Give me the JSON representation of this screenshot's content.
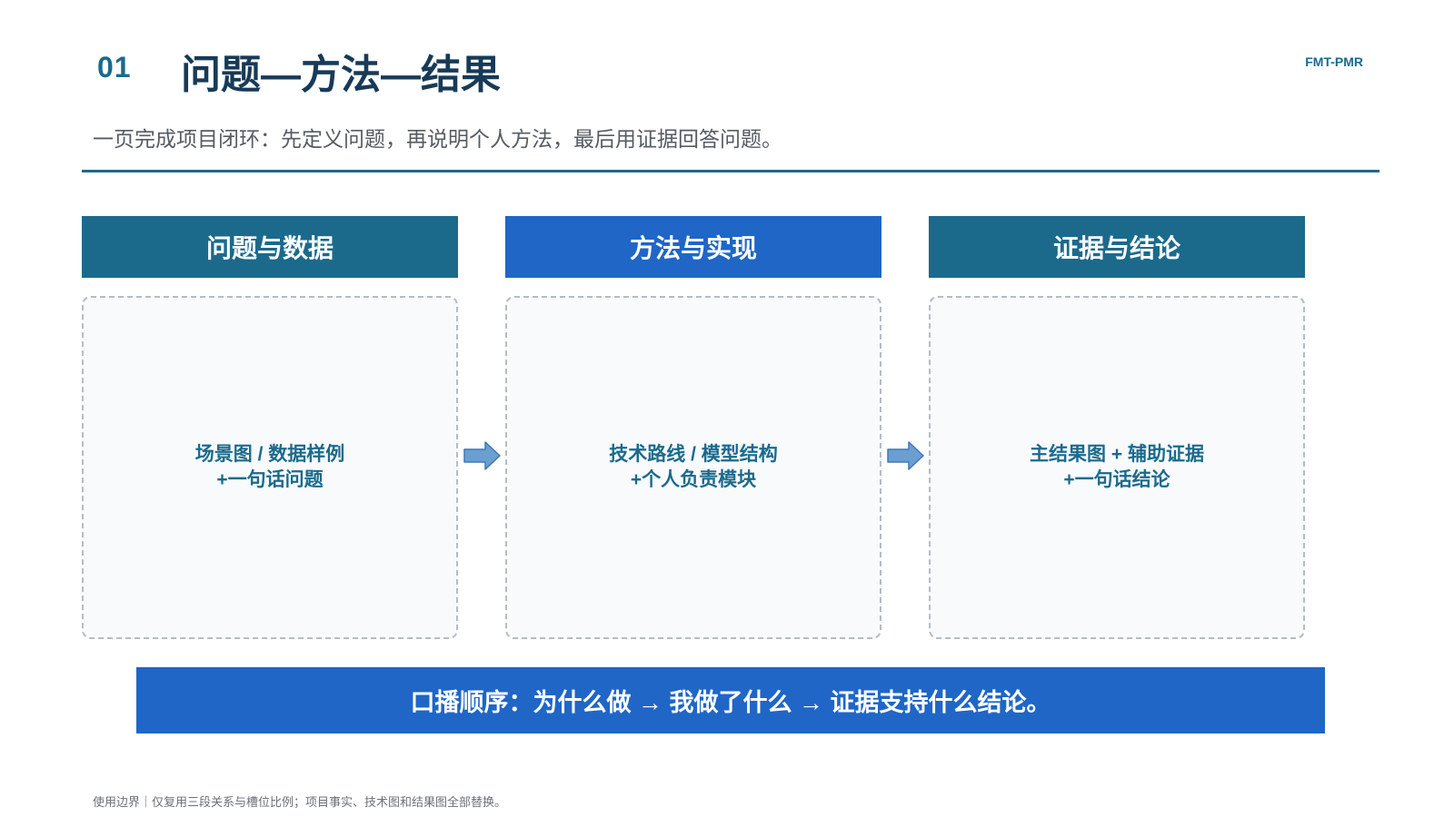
{
  "header": {
    "slide_number": "01",
    "title": "问题—方法—结果",
    "brand_tag": "FMT-PMR",
    "subtitle": "一页完成项目闭环：先定义问题，再说明个人方法，最后用证据回答问题。"
  },
  "columns": [
    {
      "header": "问题与数据",
      "placeholder_line1": "场景图 / 数据样例",
      "placeholder_line2": "+一句话问题"
    },
    {
      "header": "方法与实现",
      "placeholder_line1": "技术路线 / 模型结构",
      "placeholder_line2": "+个人负责模块"
    },
    {
      "header": "证据与结论",
      "placeholder_line1": "主结果图 + 辅助证据",
      "placeholder_line2": "+一句话结论"
    }
  ],
  "callout": {
    "text": "口播顺序：为什么做 → 我做了什么 → 证据支持什么结论。"
  },
  "footnote": "使用边界｜仅复用三段关系与槽位比例；项目事实、技术图和结果图全部替换。",
  "icons": {
    "flow_arrow": "right-arrow-icon"
  },
  "colors": {
    "teal": "#1b6a8c",
    "blue": "#1f66c7",
    "title": "#183a57",
    "arrow_fill": "#6a9fd0"
  }
}
